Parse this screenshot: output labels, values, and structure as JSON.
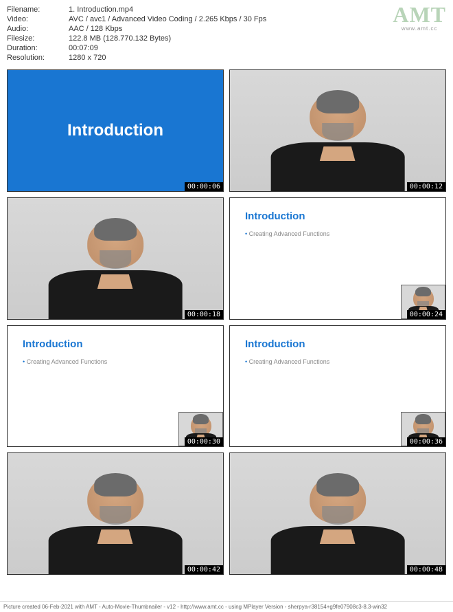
{
  "meta": {
    "filename_label": "Filename:",
    "filename_value": "1. Introduction.mp4",
    "video_label": "Video:",
    "video_value": "AVC / avc1 / Advanced Video Coding / 2.265 Kbps / 30 Fps",
    "audio_label": "Audio:",
    "audio_value": "AAC / 128 Kbps",
    "filesize_label": "Filesize:",
    "filesize_value": "122.8 MB (128.770.132 Bytes)",
    "duration_label": "Duration:",
    "duration_value": "00:07:09",
    "resolution_label": "Resolution:",
    "resolution_value": "1280 x 720"
  },
  "logo": {
    "text": "AMT",
    "url": "www.amt.cc"
  },
  "thumbs": [
    {
      "ts": "00:00:06",
      "type": "blue",
      "title": "Introduction"
    },
    {
      "ts": "00:00:12",
      "type": "person"
    },
    {
      "ts": "00:00:18",
      "type": "person"
    },
    {
      "ts": "00:00:24",
      "type": "white",
      "title": "Introduction",
      "bullet": "Creating Advanced Functions"
    },
    {
      "ts": "00:00:30",
      "type": "white",
      "title": "Introduction",
      "bullet": "Creating Advanced Functions"
    },
    {
      "ts": "00:00:36",
      "type": "white",
      "title": "Introduction",
      "bullet": "Creating Advanced Functions"
    },
    {
      "ts": "00:00:42",
      "type": "person"
    },
    {
      "ts": "00:00:48",
      "type": "person"
    }
  ],
  "footer": "Picture created 06-Feb-2021 with AMT - Auto-Movie-Thumbnailer - v12 - http://www.amt.cc - using MPlayer Version - sherpya-r38154+g9fe07908c3-8.3-win32"
}
